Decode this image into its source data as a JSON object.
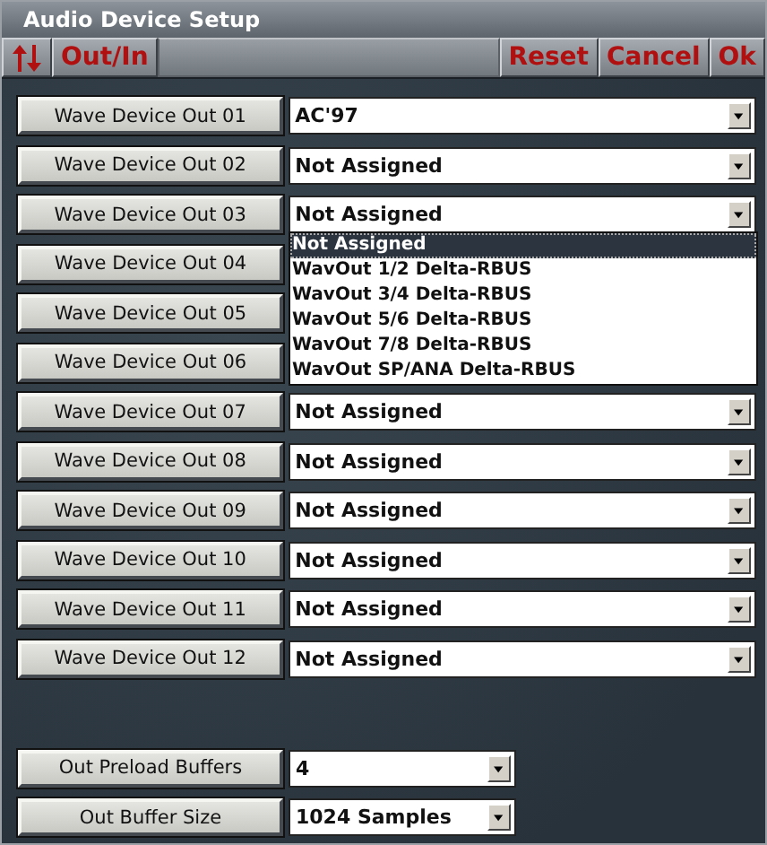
{
  "window": {
    "title": "Audio Device Setup"
  },
  "toolbar": {
    "left": [
      {
        "kind": "icon"
      },
      {
        "kind": "text",
        "label": "Out/In"
      }
    ],
    "right": [
      "Reset",
      "Cancel",
      "Ok"
    ]
  },
  "devices": [
    {
      "label": "Wave Device Out 01",
      "value": "AC'97"
    },
    {
      "label": "Wave Device Out 02",
      "value": "Not Assigned"
    },
    {
      "label": "Wave Device Out 03",
      "value": "Not Assigned",
      "open": true,
      "options": [
        {
          "label": "Not Assigned",
          "selected": true
        },
        {
          "label": "WavOut 1/2 Delta-RBUS",
          "selected": false
        },
        {
          "label": "WavOut 3/4 Delta-RBUS",
          "selected": false
        },
        {
          "label": "WavOut 5/6 Delta-RBUS",
          "selected": false
        },
        {
          "label": "WavOut 7/8 Delta-RBUS",
          "selected": false
        },
        {
          "label": "WavOut SP/ANA Delta-RBUS",
          "selected": false
        }
      ]
    },
    {
      "label": "Wave Device Out 04"
    },
    {
      "label": "Wave Device Out 05"
    },
    {
      "label": "Wave Device Out 06"
    },
    {
      "label": "Wave Device Out 07",
      "value": "Not Assigned"
    },
    {
      "label": "Wave Device Out 08",
      "value": "Not Assigned"
    },
    {
      "label": "Wave Device Out 09",
      "value": "Not Assigned"
    },
    {
      "label": "Wave Device Out 10",
      "value": "Not Assigned"
    },
    {
      "label": "Wave Device Out 11",
      "value": "Not Assigned"
    },
    {
      "label": "Wave Device Out 12",
      "value": "Not Assigned"
    }
  ],
  "buffers": [
    {
      "label": "Out Preload Buffers",
      "value": "4"
    },
    {
      "label": "Out Buffer Size",
      "value": "1024 Samples"
    }
  ]
}
